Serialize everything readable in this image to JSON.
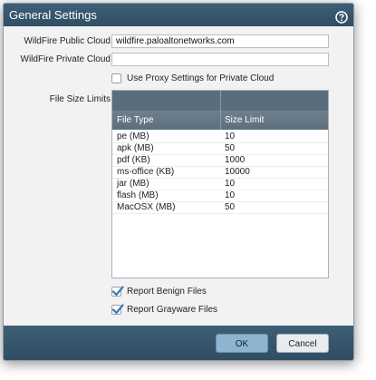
{
  "dialog": {
    "title": "General Settings",
    "help_icon": "help-icon"
  },
  "fields": {
    "public_cloud_label": "WildFire Public Cloud",
    "public_cloud_value": "wildfire.paloaltonetworks.com",
    "private_cloud_label": "WildFire Private Cloud",
    "private_cloud_value": "",
    "proxy_label": "Use Proxy Settings for Private Cloud",
    "proxy_checked": false,
    "file_size_label": "File Size Limits"
  },
  "table": {
    "columns": [
      "File Type",
      "Size Limit"
    ],
    "rows": [
      [
        "pe (MB)",
        "10"
      ],
      [
        "apk (MB)",
        "50"
      ],
      [
        "pdf (KB)",
        "1000"
      ],
      [
        "ms-office (KB)",
        "10000"
      ],
      [
        "jar (MB)",
        "10"
      ],
      [
        "flash (MB)",
        "10"
      ],
      [
        "MacOSX (MB)",
        "50"
      ]
    ]
  },
  "options": {
    "benign_label": "Report Benign Files",
    "benign_checked": true,
    "grayware_label": "Report Grayware Files",
    "grayware_checked": true
  },
  "buttons": {
    "ok": "OK",
    "cancel": "Cancel"
  },
  "colors": {
    "titlebar": "#2f4e64",
    "accent_button": "#8fb4cf",
    "check_mark": "#3a7ab8"
  }
}
